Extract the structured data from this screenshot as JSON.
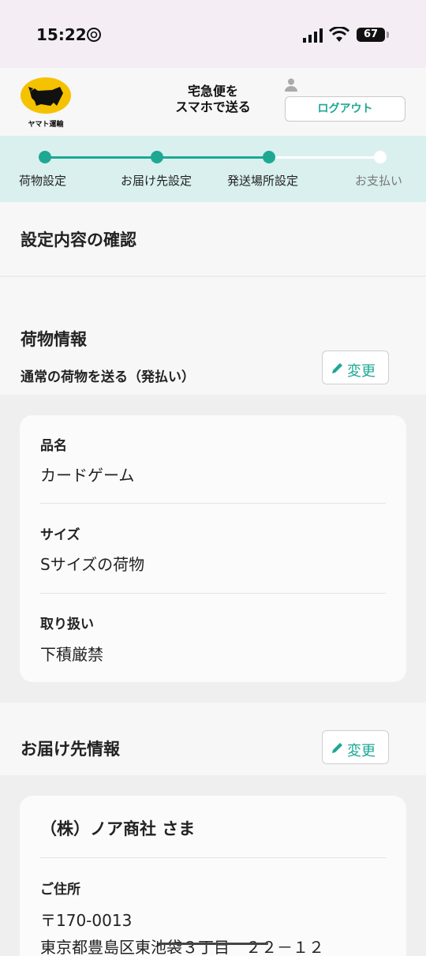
{
  "status_bar": {
    "time": "15:22",
    "battery": "67"
  },
  "header": {
    "logo_text": "ヤマト運輸",
    "title_line1": "宅急便を",
    "title_line2": "スマホで送る",
    "logout_label": "ログアウト"
  },
  "stepper": {
    "steps": [
      {
        "label": "荷物設定",
        "state": "done"
      },
      {
        "label": "お届け先設定",
        "state": "done"
      },
      {
        "label": "発送場所設定",
        "state": "current"
      },
      {
        "label": "お支払い",
        "state": "pending"
      }
    ]
  },
  "confirm": {
    "title": "設定内容の確認"
  },
  "package": {
    "title": "荷物情報",
    "subtitle": "通常の荷物を送る（発払い）",
    "change_label": "変更",
    "fields": [
      {
        "label": "品名",
        "value": "カードゲーム"
      },
      {
        "label": "サイズ",
        "value": "Sサイズの荷物"
      },
      {
        "label": "取り扱い",
        "value": "下積厳禁"
      }
    ]
  },
  "recipient": {
    "title": "お届け先情報",
    "change_label": "変更",
    "name": "（株）ノア商社 さま",
    "address_label": "ご住所",
    "postal": "〒170-0013",
    "address": "東京都豊島区東池袋３丁目　２２－１２"
  },
  "colors": {
    "accent": "#1ea894",
    "stepper_bg": "#d9f0ef",
    "logo_yellow": "#f5c200"
  }
}
